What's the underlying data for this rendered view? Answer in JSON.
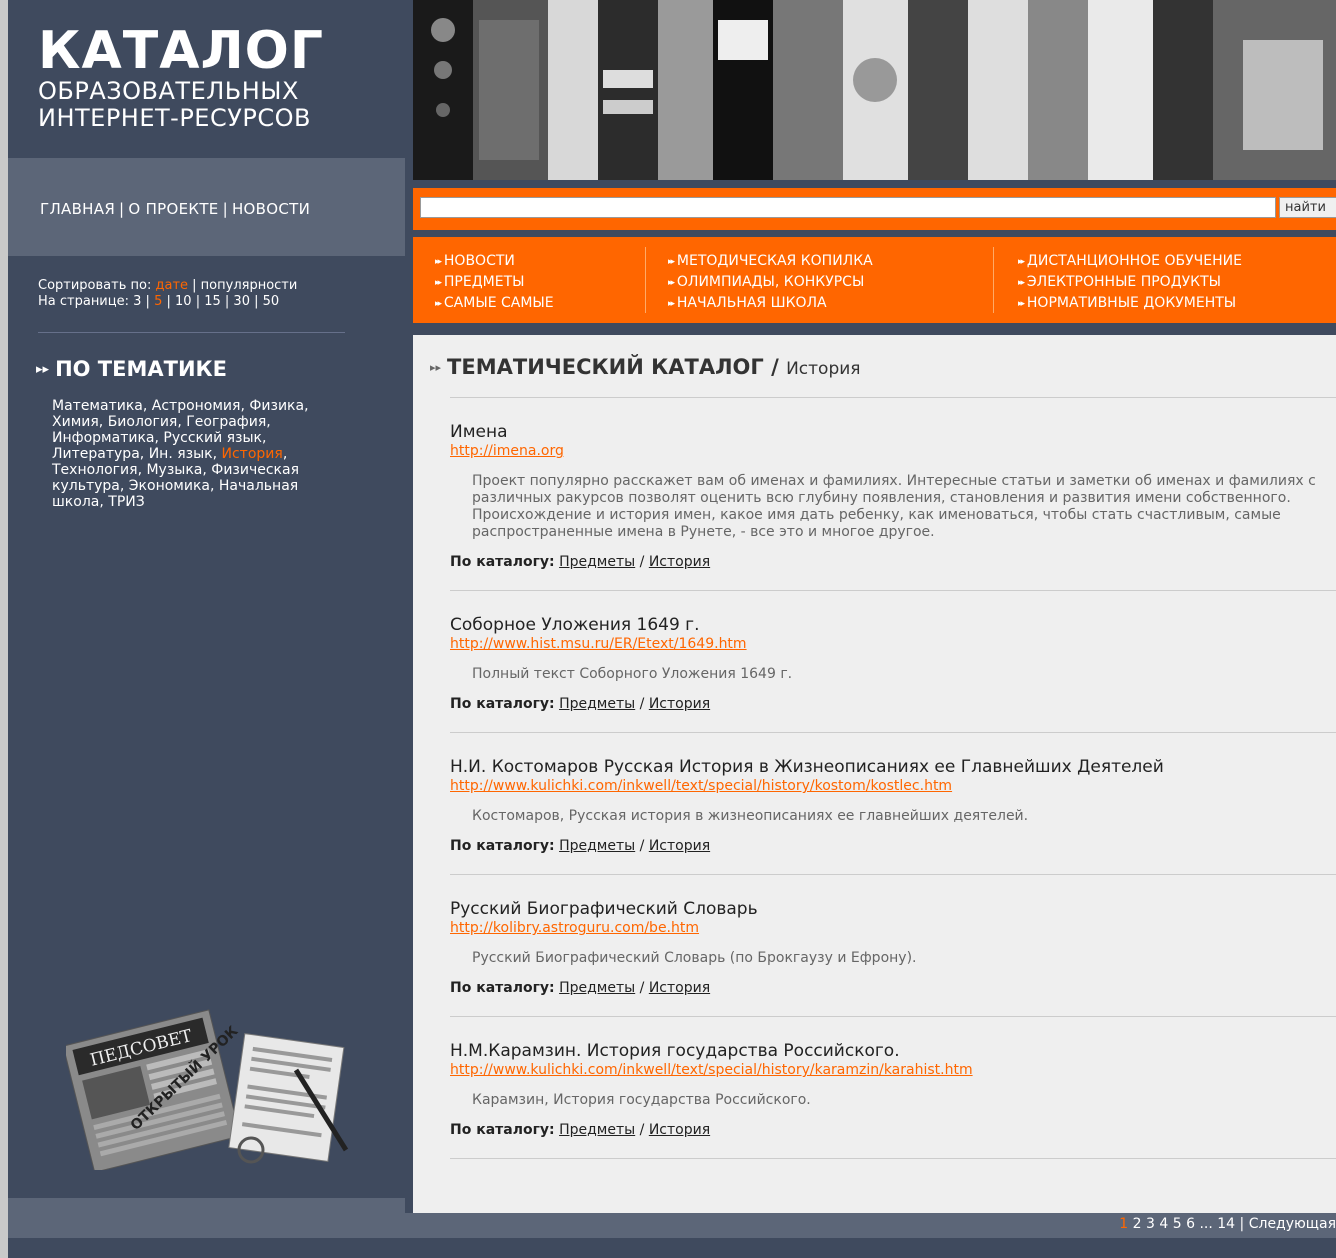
{
  "logo": {
    "line1": "КАТАЛОГ",
    "line2": "ОБРАЗОВАТЕЛЬНЫХ",
    "line3": "ИНТЕРНЕТ-РЕСУРСОВ"
  },
  "topnav": [
    "ГЛАВНАЯ",
    "О ПРОЕКТЕ",
    "НОВОСТИ"
  ],
  "sort": {
    "label": "Сортировать по:",
    "date": "дате",
    "popularity": "популярности",
    "per_page_label": "На странице:",
    "per_page": [
      "3",
      "5",
      "10",
      "15",
      "30",
      "50"
    ],
    "per_page_active": "5"
  },
  "themes": {
    "title": "ПО ТЕМАТИКЕ",
    "items": [
      "Математика",
      "Астрономия",
      "Физика",
      "Химия",
      "Биология",
      "География",
      "Информатика",
      "Русский язык",
      "Литература",
      "Ин. язык",
      "История",
      "Технология",
      "Музыка",
      "Физическая культура",
      "Экономика",
      "Начальная школа",
      "ТРИЗ"
    ],
    "active": "История"
  },
  "magazine": {
    "title": "ПЕДСОВЕТ",
    "stamp": "ОТКРЫТЫЙ УРОК"
  },
  "search": {
    "value": "",
    "button": "найти"
  },
  "nav": {
    "col1": [
      "НОВОСТИ",
      "ПРЕДМЕТЫ",
      "САМЫЕ САМЫЕ"
    ],
    "col2": [
      "МЕТОДИЧЕСКАЯ КОПИЛКА",
      "ОЛИМПИАДЫ, КОНКУРСЫ",
      "НАЧАЛЬНАЯ ШКОЛА"
    ],
    "col3": [
      "ДИСТАНЦИОННОЕ ОБУЧЕНИЕ",
      "ЭЛЕКТРОННЫЕ ПРОДУКТЫ",
      "НОРМАТИВНЫЕ ДОКУМЕНТЫ"
    ]
  },
  "catalog": {
    "title": "ТЕМАТИЧЕСКИЙ КАТАЛОГ",
    "slash": "/",
    "sub": "История",
    "by_catalog_label": "По каталогу:",
    "entries": [
      {
        "title": "Имена",
        "url": "http://imena.org",
        "desc": "Проект популярно расскажет вам об именах и фамилиях. Интересные статьи и заметки об именах и фамилиях с различных ракурсов позволят оценить всю глубину появления, становления и развития имени собственного. Происхождение и история имен, какое имя дать ребенку, как именоваться, чтобы стать счастливым, самые распространенные имена в Рунете, - все это и многое другое.",
        "cat1": "Предметы",
        "cat2": "История"
      },
      {
        "title": "Соборное Уложения 1649 г.",
        "url": "http://www.hist.msu.ru/ER/Etext/1649.htm",
        "desc": "Полный текст Соборного Уложения 1649 г.",
        "cat1": "Предметы",
        "cat2": "История"
      },
      {
        "title": "Н.И. Костомаров Русская История в Жизнеописаниях ее Главнейших Деятелей",
        "url": "http://www.kulichki.com/inkwell/text/special/history/kostom/kostlec.htm",
        "desc": "Костомаров, Русская история в жизнеописаниях ее главнейших деятелей.",
        "cat1": "Предметы",
        "cat2": "История"
      },
      {
        "title": "Русский Биографический Словарь",
        "url": "http://kolibry.astroguru.com/be.htm",
        "desc": "Русский Биографический Словарь (по Брокгаузу и Ефрону).",
        "cat1": "Предметы",
        "cat2": "История"
      },
      {
        "title": "Н.М.Карамзин. История государства Российского.",
        "url": "http://www.kulichki.com/inkwell/text/special/history/karamzin/karahist.htm",
        "desc": "Карамзин, История государства Российского.",
        "cat1": "Предметы",
        "cat2": "История"
      }
    ]
  },
  "pager": {
    "pages": [
      "1",
      "2",
      "3",
      "4",
      "5",
      "6"
    ],
    "active": "1",
    "ellipsis": "...",
    "last": "14",
    "next": "Следующая"
  },
  "colors": {
    "accent": "#ff6600",
    "dark": "#3f4a5e",
    "mid": "#5c6678",
    "content_bg": "#efefef"
  }
}
